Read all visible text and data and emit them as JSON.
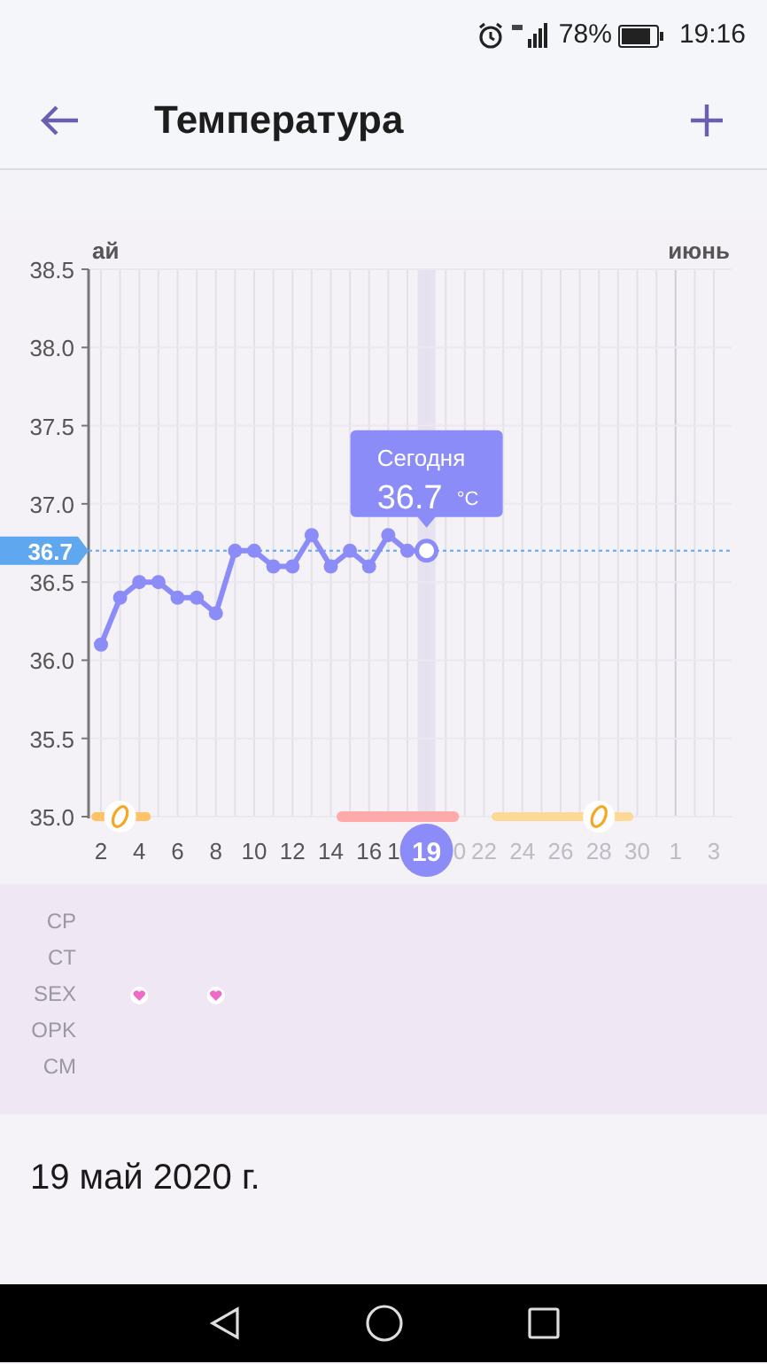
{
  "status_bar": {
    "battery": "78%",
    "time": "19:16"
  },
  "header": {
    "title": "Температура"
  },
  "chart": {
    "months": [
      "ай",
      "июнь"
    ],
    "tooltip": {
      "title": "Сегодня",
      "value": "36.7",
      "unit": "°C"
    },
    "today_badge": {
      "label": "19",
      "left_fragment": "1",
      "right_fragment": "0"
    },
    "next_month_labels": [
      "1",
      "3"
    ],
    "cycle_phases": [
      {
        "kind": "fertile",
        "color": "#ffc266",
        "ovulation": true
      },
      {
        "kind": "period",
        "color": "#ffaaaa",
        "ovulation": false
      },
      {
        "kind": "fertile",
        "color": "#fdd995",
        "ovulation": true
      }
    ],
    "chart_data": {
      "type": "line",
      "x": [
        2,
        3,
        4,
        5,
        6,
        7,
        8,
        9,
        10,
        11,
        12,
        13,
        14,
        15,
        16,
        17,
        18,
        19
      ],
      "series": [
        {
          "color": "#8b8cf8",
          "marker": "o",
          "values": [
            36.1,
            36.4,
            36.5,
            36.5,
            36.4,
            36.4,
            36.3,
            36.7,
            36.7,
            36.6,
            36.6,
            36.8,
            36.6,
            36.7,
            36.6,
            36.8,
            36.7,
            36.7
          ]
        }
      ],
      "xlim": [
        2,
        34
      ],
      "ylim": [
        35.0,
        38.5
      ],
      "grid": true,
      "yticks": [
        {
          "value": 35.0,
          "label": "35.0"
        },
        {
          "value": 35.5,
          "label": "35.5"
        },
        {
          "value": 36.0,
          "label": "36.0"
        },
        {
          "value": 36.5,
          "label": "36.5"
        },
        {
          "value": 37.0,
          "label": "37.0"
        },
        {
          "value": 37.5,
          "label": "37.5"
        },
        {
          "value": 38.0,
          "label": "38.0"
        },
        {
          "value": 38.5,
          "label": "38.5"
        }
      ],
      "xticks": [
        2,
        4,
        6,
        8,
        10,
        12,
        14,
        16,
        22,
        24,
        26,
        28,
        30
      ],
      "ref_lines": [
        {
          "axis": "y",
          "value": 36.7,
          "label": "36.7",
          "color": "#5fa8f0"
        }
      ]
    }
  },
  "tracker_rows": [
    {
      "label": "CP"
    },
    {
      "label": "CT"
    },
    {
      "label": "SEX",
      "hearts": [
        false,
        false,
        true,
        false,
        false,
        false,
        true
      ]
    },
    {
      "label": "OPK"
    },
    {
      "label": "CM"
    }
  ],
  "date": "19 май 2020 г."
}
